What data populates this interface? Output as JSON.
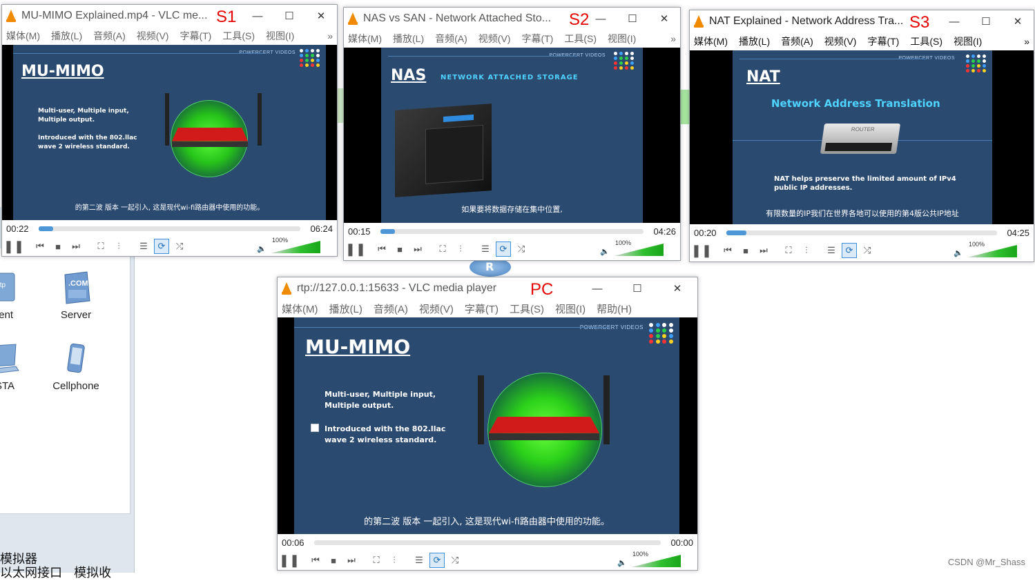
{
  "background": {
    "devices": [
      {
        "label": "ient",
        "icon": "client-icon"
      },
      {
        "label": "Server",
        "icon": "server-icon"
      },
      {
        "label": "STA",
        "icon": "laptop-icon"
      },
      {
        "label": "Cellphone",
        "icon": "cellphone-icon"
      }
    ],
    "server_icon_text": ".COM",
    "client_icon_text": "ttp",
    "bottom_text_1": "模拟器",
    "bottom_text_2": "以太网接口",
    "bottom_text_3": "模拟收",
    "router_letter": "R",
    "watermark": "CSDN @Mr_Shass"
  },
  "menus": {
    "media": "媒体(M)",
    "playback": "播放(L)",
    "audio": "音频(A)",
    "video": "视频(V)",
    "subtitle": "字幕(T)",
    "tools": "工具(S)",
    "view": "视图(I)",
    "help": "帮助(H)",
    "more": "»"
  },
  "windows": [
    {
      "id": "s1",
      "title": "MU-MIMO Explained.mp4 - VLC me...",
      "label": "S1",
      "heading": "MU-MIMO",
      "subheading": "",
      "body_lines": [
        "Multi-user, Multiple input,",
        "Multiple output.",
        "",
        "Introduced with the 802.llac",
        "wave 2 wireless standard."
      ],
      "caption": "的第二波 版本 一起引入,  这是现代wi-fi路由器中使用的功能。",
      "brand": "POWERCERT VIDEOS",
      "elapsed": "00:22",
      "duration": "06:24",
      "progress": 0.057,
      "volume": "100%"
    },
    {
      "id": "s2",
      "title": "NAS vs SAN - Network Attached Sto...",
      "label": "S2",
      "heading": "NAS",
      "subheading": "NETWORK ATTACHED STORAGE",
      "body_lines": [],
      "caption": "如果要将数据存储在集中位置,",
      "brand": "POWERCERT VIDEOS",
      "elapsed": "00:15",
      "duration": "04:26",
      "progress": 0.056,
      "volume": "100%"
    },
    {
      "id": "s3",
      "title": "NAT Explained - Network Address Tra...",
      "label": "S3",
      "heading": "NAT",
      "subheading": "Network Address Translation",
      "body_lines": [
        "NAT helps preserve the limited amount of IPv4",
        "public IP addresses."
      ],
      "device_label": "ROUTER",
      "caption": "有限数量的IP我们在世界各地可以使用的第4版公共IP地址",
      "brand": "POWERCERT VIDEOS",
      "elapsed": "00:20",
      "duration": "04:25",
      "progress": 0.075,
      "volume": "100%"
    },
    {
      "id": "pc",
      "title": "rtp://127.0.0.1:15633 - VLC media player",
      "label": "PC",
      "heading": "MU-MIMO",
      "subheading": "",
      "body_lines": [
        "Multi-user, Multiple input,",
        "Multiple output.",
        "",
        "Introduced with the 802.llac",
        "wave 2 wireless standard."
      ],
      "caption": "的第二波 版本 一起引入,  这是现代wi-fi路由器中使用的功能。",
      "brand": "POWERCERT VIDEOS",
      "elapsed": "00:06",
      "duration": "00:00",
      "progress": 0,
      "volume": "100%"
    }
  ],
  "colors": {
    "label_red": "#e60000",
    "vlc_orange": "#f08a00",
    "slide_blue": "#2b4a70",
    "progress_blue": "#4e97d6",
    "volume_green": "#2fbf2f"
  }
}
